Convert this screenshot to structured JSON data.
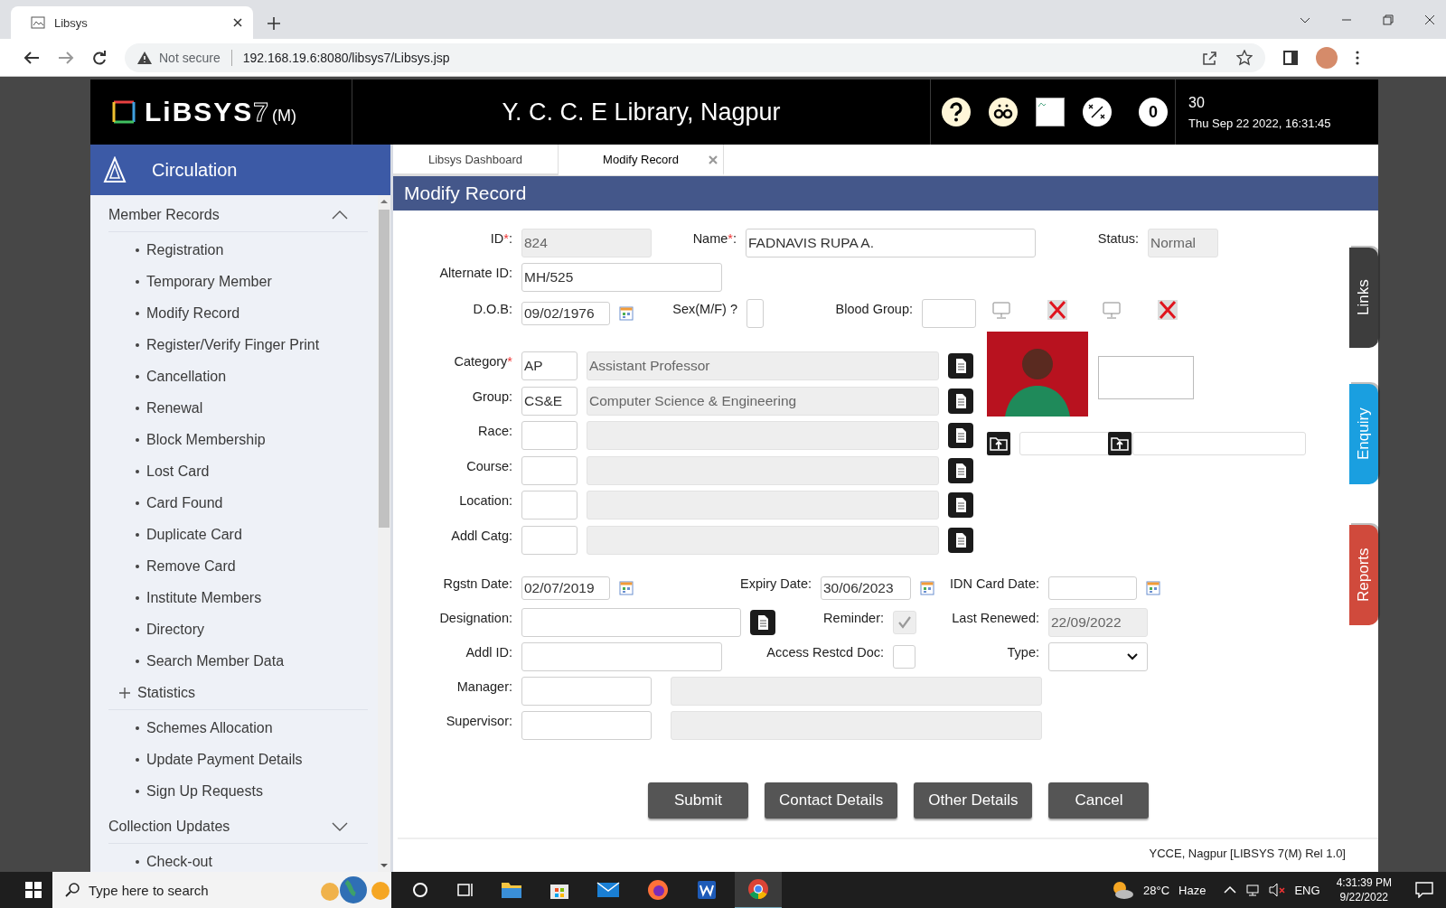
{
  "browser": {
    "tab_title": "Libsys",
    "security": "Not secure",
    "url": "192.168.19.6:8080/libsys7/Libsys.jsp"
  },
  "header": {
    "logo": "LiBSYS",
    "logo_version": "7",
    "logo_edition": "(M)",
    "title": "Y. C. C. E Library, Nagpur",
    "notification_count": "0",
    "date_day": "30",
    "datetime": "Thu Sep 22 2022, 16:31:45"
  },
  "sidebar": {
    "title": "Circulation",
    "sections": [
      {
        "label": "Member Records",
        "expanded": true,
        "items": [
          {
            "kind": "link",
            "label": "Registration"
          },
          {
            "kind": "link",
            "label": "Temporary Member"
          },
          {
            "kind": "link",
            "label": "Modify Record"
          },
          {
            "kind": "link",
            "label": "Register/Verify Finger Print"
          },
          {
            "kind": "link",
            "label": "Cancellation"
          },
          {
            "kind": "link",
            "label": "Renewal"
          },
          {
            "kind": "link",
            "label": "Block Membership"
          },
          {
            "kind": "link",
            "label": "Lost Card"
          },
          {
            "kind": "link",
            "label": "Card Found"
          },
          {
            "kind": "link",
            "label": "Duplicate Card"
          },
          {
            "kind": "link",
            "label": "Remove Card"
          },
          {
            "kind": "link",
            "label": "Institute Members"
          },
          {
            "kind": "link",
            "label": "Directory"
          },
          {
            "kind": "link",
            "label": "Search Member Data"
          },
          {
            "kind": "group",
            "label": "Statistics",
            "expanded": false
          },
          {
            "kind": "link",
            "label": "Schemes Allocation"
          },
          {
            "kind": "link",
            "label": "Update Payment Details"
          },
          {
            "kind": "link",
            "label": "Sign Up Requests"
          }
        ]
      },
      {
        "label": "Collection Updates",
        "expanded": false,
        "items": [
          {
            "kind": "link",
            "label": "Check-out"
          }
        ]
      }
    ]
  },
  "content_tabs": [
    {
      "label": "Libsys Dashboard",
      "selected": false,
      "closable": false
    },
    {
      "label": "Modify Record",
      "selected": true,
      "closable": true
    }
  ],
  "form": {
    "title": "Modify Record",
    "top_rows": [
      {
        "fields": [
          {
            "kind": "text",
            "label": "ID",
            "mark": "*",
            "tail": ":",
            "value": "824",
            "disabled": true
          },
          {
            "kind": "text",
            "label": "Name",
            "mark": "*",
            "tail": ":",
            "value": "FADNAVIS RUPA A.",
            "disabled": false
          },
          {
            "kind": "text",
            "label": "Status:",
            "value": "Normal",
            "disabled": true
          }
        ]
      },
      {
        "fields": [
          {
            "kind": "text",
            "label": "Alternate ID:",
            "value": "MH/525",
            "disabled": false
          }
        ]
      },
      {
        "fields": [
          {
            "kind": "date",
            "label": "D.O.B:",
            "value": "09/02/1976"
          },
          {
            "kind": "text",
            "label": "Sex(M/F) ?",
            "disabled": false
          },
          {
            "kind": "text",
            "label": "Blood Group:",
            "disabled": false
          }
        ]
      }
    ],
    "lookups": [
      {
        "kind": "lookup",
        "label": "Category",
        "mark": "*",
        "code": "AP",
        "description": "Assistant Professor"
      },
      {
        "kind": "lookup",
        "label": "Group:",
        "code": "CS&E",
        "description": "Computer Science & Engineering"
      },
      {
        "kind": "lookup",
        "label": "Race:"
      },
      {
        "kind": "lookup",
        "label": "Course:"
      },
      {
        "kind": "lookup",
        "label": "Location:"
      },
      {
        "kind": "lookup",
        "label": "Addl Catg:"
      }
    ],
    "bottom_rows": [
      {
        "fields": [
          {
            "kind": "date",
            "label": "Rgstn Date:",
            "value": "02/07/2019"
          },
          {
            "kind": "date",
            "label": "Expiry Date:",
            "value": "30/06/2023"
          },
          {
            "kind": "date",
            "label": "IDN Card Date:"
          }
        ]
      },
      {
        "fields": [
          {
            "kind": "picker",
            "label": "Designation:"
          },
          {
            "kind": "checkbox",
            "label": "Reminder:",
            "checked": true,
            "disabled": true
          },
          {
            "kind": "text",
            "label": "Last Renewed:",
            "value": "22/09/2022",
            "disabled": true
          }
        ]
      },
      {
        "fields": [
          {
            "kind": "text",
            "label": "Addl ID:",
            "disabled": false
          },
          {
            "kind": "checkbox",
            "label": "Access Restcd Doc:",
            "checked": false,
            "disabled": false
          },
          {
            "kind": "select",
            "label": "Type:"
          }
        ]
      },
      {
        "fields": [
          {
            "kind": "pair",
            "label": "Manager:"
          }
        ]
      },
      {
        "fields": [
          {
            "kind": "pair",
            "label": "Supervisor:"
          }
        ]
      }
    ],
    "buttons": [
      "Submit",
      "Contact Details",
      "Other Details",
      "Cancel"
    ],
    "footer": "YCCE, Nagpur [LIBSYS 7(M) Rel 1.0]"
  },
  "side_tabs": [
    {
      "label": "Links",
      "color": "#3d3d3d"
    },
    {
      "label": "Enquiry",
      "color": "#1a9fe0"
    },
    {
      "label": "Reports",
      "color": "#d04a3c"
    }
  ],
  "taskbar": {
    "search_placeholder": "Type here to search",
    "temperature": "28°C",
    "weather": "Haze",
    "language": "ENG",
    "time": "4:31:39 PM",
    "date": "9/22/2022"
  }
}
